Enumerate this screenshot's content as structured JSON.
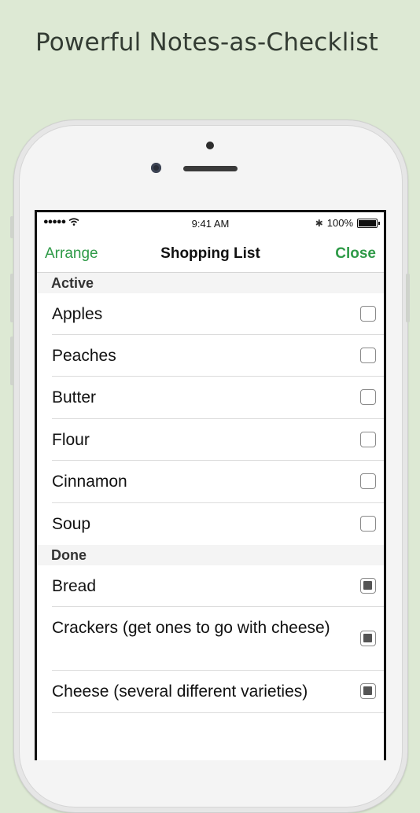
{
  "headline": "Powerful Notes-as-Checklist",
  "status_bar": {
    "signal": "●●●●●",
    "wifi": "wifi-icon",
    "time": "9:41 AM",
    "bluetooth": "✱",
    "battery_percent": "100%"
  },
  "nav": {
    "left_button": "Arrange",
    "title": "Shopping List",
    "right_button": "Close",
    "accent_color": "#2e9a47"
  },
  "sections": {
    "active": {
      "header": "Active",
      "items": [
        {
          "label": "Apples",
          "checked": false
        },
        {
          "label": "Peaches",
          "checked": false
        },
        {
          "label": "Butter",
          "checked": false
        },
        {
          "label": "Flour",
          "checked": false
        },
        {
          "label": "Cinnamon",
          "checked": false
        },
        {
          "label": "Soup",
          "checked": false
        }
      ]
    },
    "done": {
      "header": "Done",
      "items": [
        {
          "label": "Bread",
          "checked": true
        },
        {
          "label": "Crackers (get ones to go with cheese)",
          "checked": true
        },
        {
          "label": "Cheese (several different varieties)",
          "checked": true
        }
      ]
    }
  }
}
